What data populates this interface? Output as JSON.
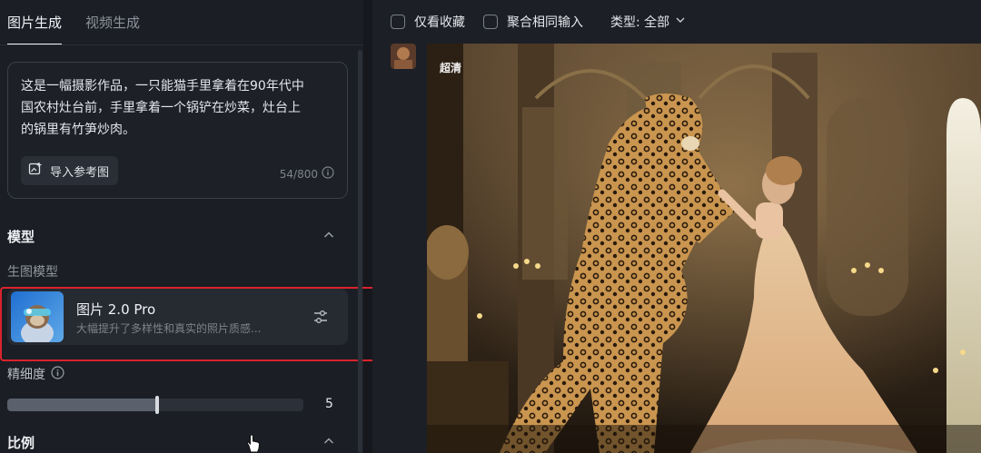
{
  "tabs": [
    {
      "label": "图片生成",
      "active": true
    },
    {
      "label": "视频生成",
      "active": false
    }
  ],
  "prompt": {
    "text": "这是一幅摄影作品，一只能猫手里拿着在90年代中\n国农村灶台前，手里拿着一个锅铲在炒菜，灶台上\n的锅里有竹笋炒肉。",
    "reference_button": "导入参考图",
    "char_count": "54/800"
  },
  "model_section": {
    "title": "模型",
    "sub_label": "生图模型",
    "model_name": "图片 2.0 Pro",
    "model_desc": "大幅提升了多样性和真实的照片质感..."
  },
  "detail": {
    "label": "精细度",
    "value": "5",
    "level": 0.5
  },
  "ratio_section": {
    "title": "比例"
  },
  "filters": {
    "favorites_label": "仅看收藏",
    "merge_label": "聚合相同输入",
    "type_label": "类型: 全部"
  },
  "result": {
    "quality_badge": "超清"
  },
  "colors": {
    "highlight": "#d9232c",
    "accent_gold": "#c9a25a"
  },
  "icons": [
    "image-upload-icon",
    "info-icon",
    "chevron-up-icon",
    "sliders-icon",
    "chevron-down-icon",
    "hand-cursor-icon"
  ]
}
